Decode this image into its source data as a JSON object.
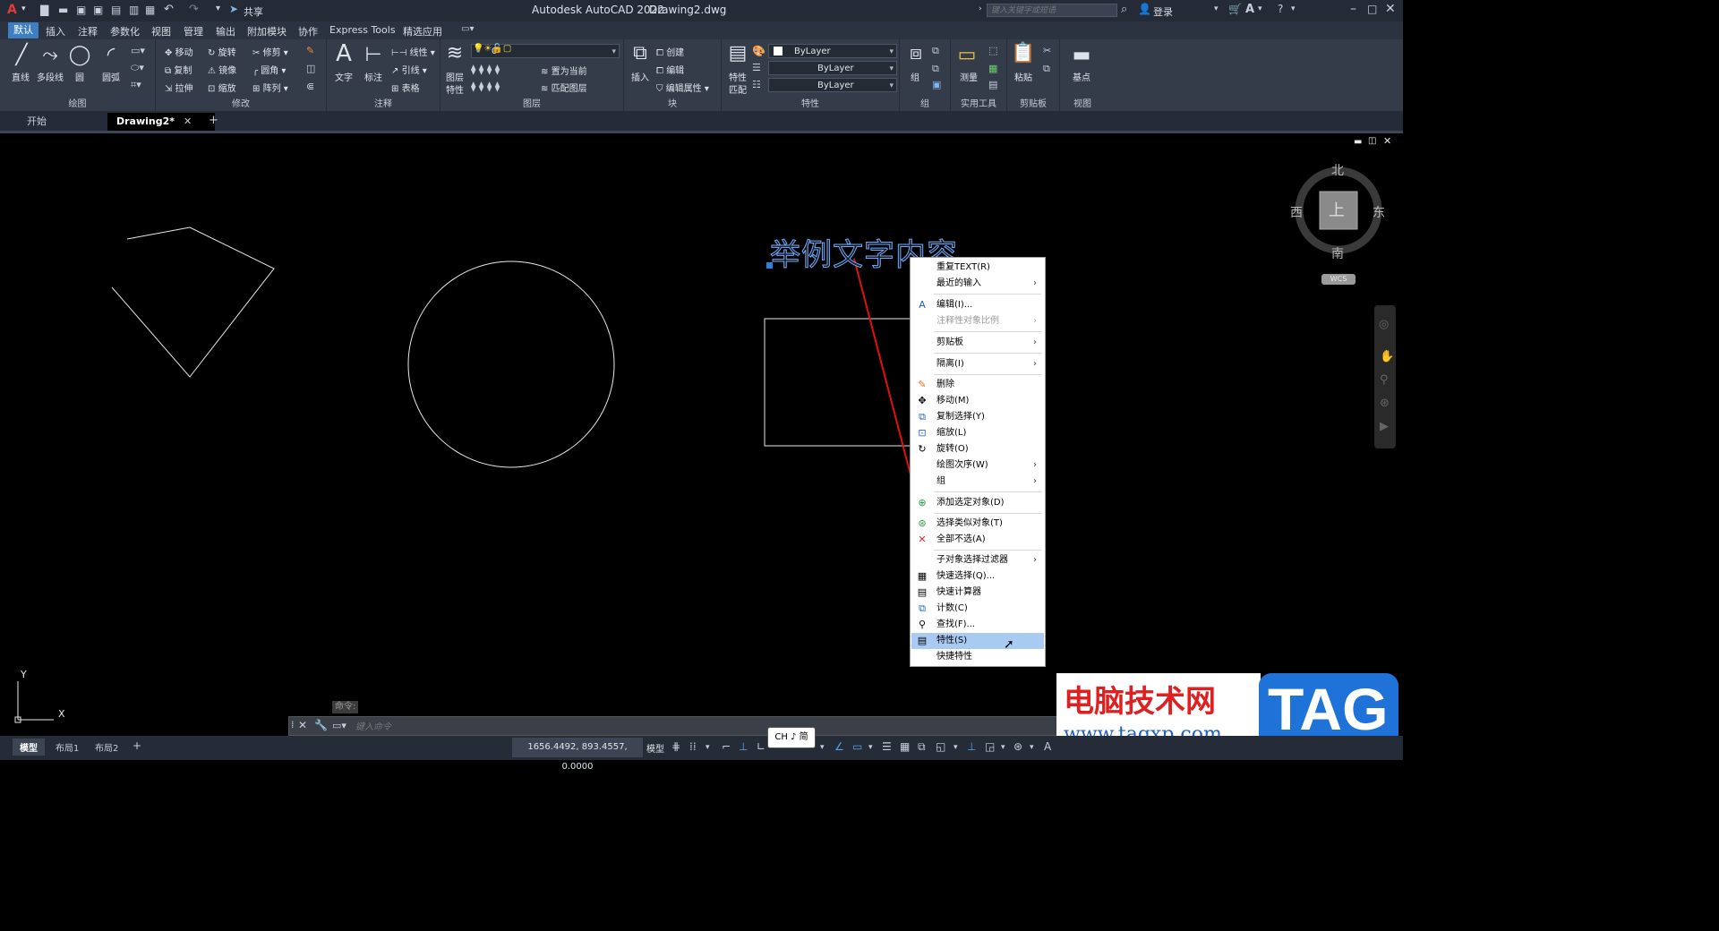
{
  "titlebar": {
    "app_title": "Autodesk AutoCAD 2022",
    "file_name": "Drawing2.dwg",
    "share_label": "共享",
    "search_placeholder": "键入关键字或短语",
    "login_label": "登录"
  },
  "menu": {
    "items": [
      "默认",
      "插入",
      "注释",
      "参数化",
      "视图",
      "管理",
      "输出",
      "附加模块",
      "协作",
      "Express Tools",
      "精选应用"
    ]
  },
  "ribbon": {
    "draw": {
      "line": "直线",
      "polyline": "多段线",
      "circle": "圆",
      "arc": "圆弧",
      "title": "绘图"
    },
    "modify": {
      "move": "移动",
      "rotate": "旋转",
      "trim": "修剪",
      "copy": "复制",
      "mirror": "镜像",
      "fillet": "圆角",
      "stretch": "拉伸",
      "scale": "缩放",
      "array": "阵列",
      "title": "修改"
    },
    "annotation": {
      "text": "文字",
      "dimension": "标注",
      "linear": "线性",
      "leader": "引线",
      "table": "表格",
      "title": "注释"
    },
    "layers": {
      "layer_props_1": "图层",
      "layer_props_2": "特性",
      "layer_value": "0",
      "set_current": "置为当前",
      "match_layer": "匹配图层",
      "title": "图层"
    },
    "block": {
      "insert": "插入",
      "create": "创建",
      "edit": "编辑",
      "edit_attr": "编辑属性",
      "title": "块"
    },
    "properties": {
      "match_1": "特性",
      "match_2": "匹配",
      "color": "ByLayer",
      "linetype": "ByLayer",
      "lineweight": "ByLayer",
      "title": "特性"
    },
    "groups": {
      "group": "组",
      "title": "组"
    },
    "utilities": {
      "measure": "测量",
      "title": "实用工具"
    },
    "clipboard": {
      "paste": "粘贴",
      "title": "剪贴板"
    },
    "view": {
      "base": "基点",
      "title": "视图"
    }
  },
  "tabs": {
    "start": "开始",
    "drawing": "Drawing2*"
  },
  "canvas": {
    "text_object": "举例文字内容",
    "compass": {
      "north": "北",
      "south": "南",
      "east": "东",
      "west": "西",
      "top": "上",
      "wcs": "WCS"
    },
    "ucs": {
      "x": "X",
      "y": "Y"
    }
  },
  "context_menu": {
    "items": [
      {
        "label": "重复TEXT(R)"
      },
      {
        "label": "最近的输入",
        "submenu": "›"
      },
      {
        "label": "编辑(I)..."
      },
      {
        "label": "注释性对象比例",
        "submenu": "›"
      },
      {
        "label": "剪贴板",
        "submenu": "›"
      },
      {
        "label": "隔离(I)",
        "submenu": "›"
      },
      {
        "label": "删除"
      },
      {
        "label": "移动(M)"
      },
      {
        "label": "复制选择(Y)"
      },
      {
        "label": "缩放(L)"
      },
      {
        "label": "旋转(O)"
      },
      {
        "label": "绘图次序(W)",
        "submenu": "›"
      },
      {
        "label": "组",
        "submenu": "›"
      },
      {
        "label": "添加选定对象(D)"
      },
      {
        "label": "选择类似对象(T)"
      },
      {
        "label": "全部不选(A)"
      },
      {
        "label": "子对象选择过滤器",
        "submenu": "›"
      },
      {
        "label": "快速选择(Q)..."
      },
      {
        "label": "快速计算器"
      },
      {
        "label": "计数(C)"
      },
      {
        "label": "查找(F)..."
      },
      {
        "label": "特性(S)"
      },
      {
        "label": "快捷特性"
      }
    ]
  },
  "command": {
    "history": "命令:",
    "placeholder": "键入命令"
  },
  "ime": {
    "label": "CH ♪ 简"
  },
  "statusbar": {
    "model_tab": "模型",
    "layout1": "布局1",
    "layout2": "布局2",
    "coords": "1656.4492, 893.4557, 0.0000",
    "model_label": "模型"
  },
  "watermark": {
    "site_cn": "电脑技术网",
    "site_url": "www.tagxp.com",
    "tag": "TAG"
  },
  "colors": {
    "accent": "#3e7fc1",
    "text_object": "#6fa8ff",
    "highlight": "#a9cbf1",
    "arrow": "#e01010"
  }
}
